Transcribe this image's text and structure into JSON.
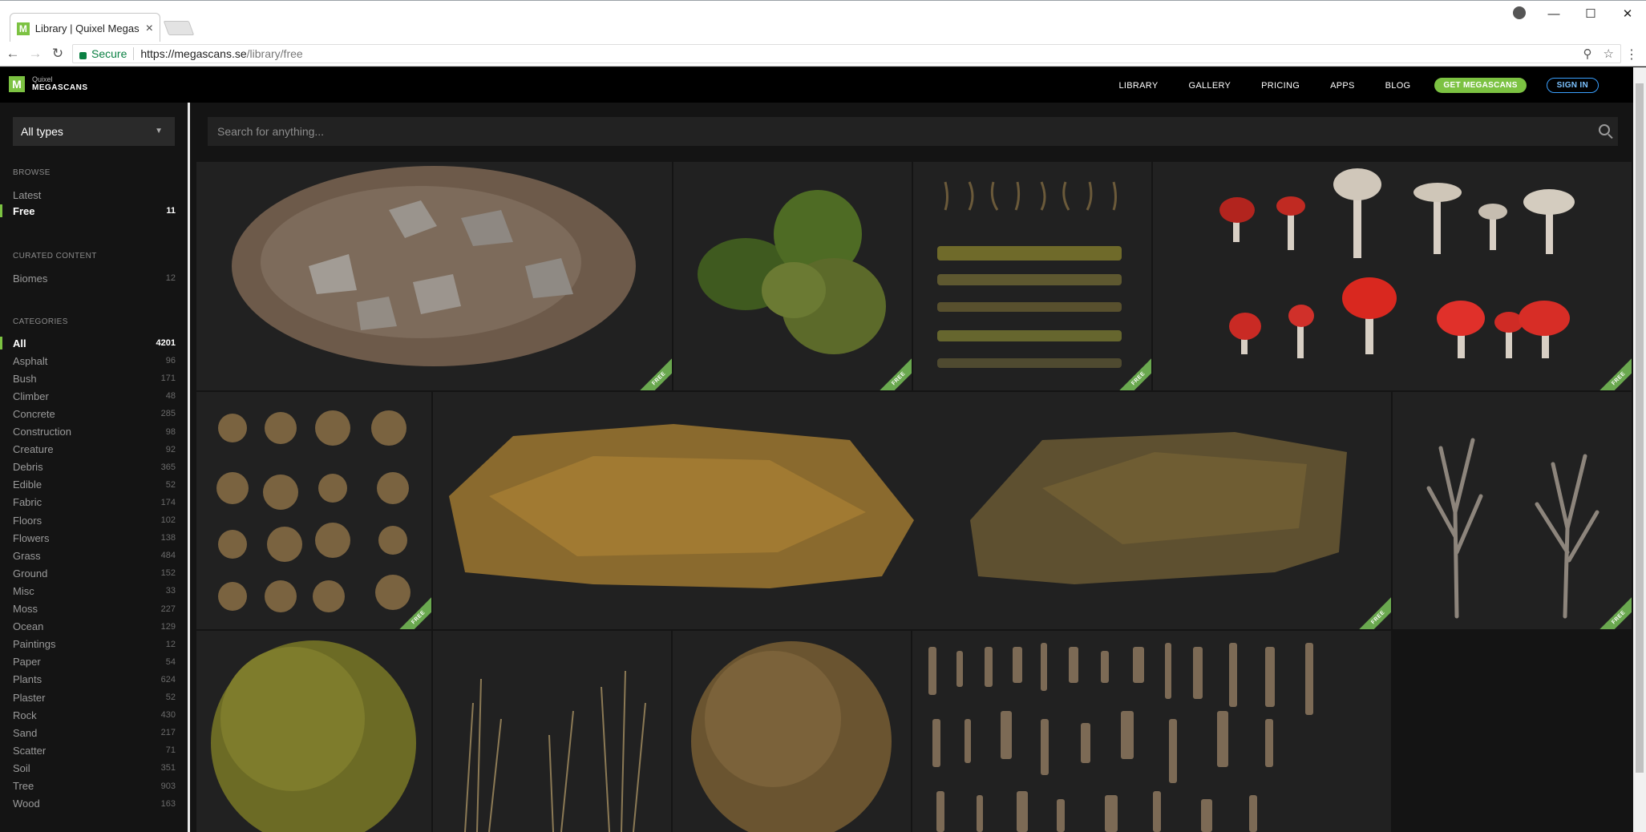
{
  "browser": {
    "tab_title": "Library | Quixel Megascans",
    "tab_favicon": "M",
    "close_glyph": "×",
    "secure_label": "Secure",
    "url_host": "https://megascans.se",
    "url_path": "/library/free"
  },
  "header": {
    "logo_mark": "M",
    "logo_small": "Quixel",
    "logo_big": "MEGASCANS",
    "nav": [
      "LIBRARY",
      "GALLERY",
      "PRICING",
      "APPS",
      "BLOG"
    ],
    "get_label": "GET MEGASCANS",
    "signin_label": "SIGN IN"
  },
  "sidebar": {
    "type_select": "All types",
    "browse_heading": "BROWSE",
    "browse": [
      {
        "label": "Latest",
        "count": ""
      },
      {
        "label": "Free",
        "count": "11"
      }
    ],
    "curated_heading": "CURATED CONTENT",
    "curated": [
      {
        "label": "Biomes",
        "count": "12"
      }
    ],
    "categories_heading": "CATEGORIES",
    "categories": [
      {
        "label": "All",
        "count": "4201"
      },
      {
        "label": "Asphalt",
        "count": "96"
      },
      {
        "label": "Bush",
        "count": "171"
      },
      {
        "label": "Climber",
        "count": "48"
      },
      {
        "label": "Concrete",
        "count": "285"
      },
      {
        "label": "Construction",
        "count": "98"
      },
      {
        "label": "Creature",
        "count": "92"
      },
      {
        "label": "Debris",
        "count": "365"
      },
      {
        "label": "Edible",
        "count": "52"
      },
      {
        "label": "Fabric",
        "count": "174"
      },
      {
        "label": "Floors",
        "count": "102"
      },
      {
        "label": "Flowers",
        "count": "138"
      },
      {
        "label": "Grass",
        "count": "484"
      },
      {
        "label": "Ground",
        "count": "152"
      },
      {
        "label": "Misc",
        "count": "33"
      },
      {
        "label": "Moss",
        "count": "227"
      },
      {
        "label": "Ocean",
        "count": "129"
      },
      {
        "label": "Paintings",
        "count": "12"
      },
      {
        "label": "Paper",
        "count": "54"
      },
      {
        "label": "Plants",
        "count": "624"
      },
      {
        "label": "Plaster",
        "count": "52"
      },
      {
        "label": "Rock",
        "count": "430"
      },
      {
        "label": "Sand",
        "count": "217"
      },
      {
        "label": "Scatter",
        "count": "71"
      },
      {
        "label": "Soil",
        "count": "351"
      },
      {
        "label": "Tree",
        "count": "903"
      },
      {
        "label": "Wood",
        "count": "163"
      }
    ]
  },
  "search": {
    "placeholder": "Search for anything..."
  },
  "grid": {
    "badge_label": "FREE"
  },
  "colors": {
    "accent": "#7cc242",
    "signin": "#3aa0ff",
    "background": "#141414",
    "tile": "#212121"
  }
}
